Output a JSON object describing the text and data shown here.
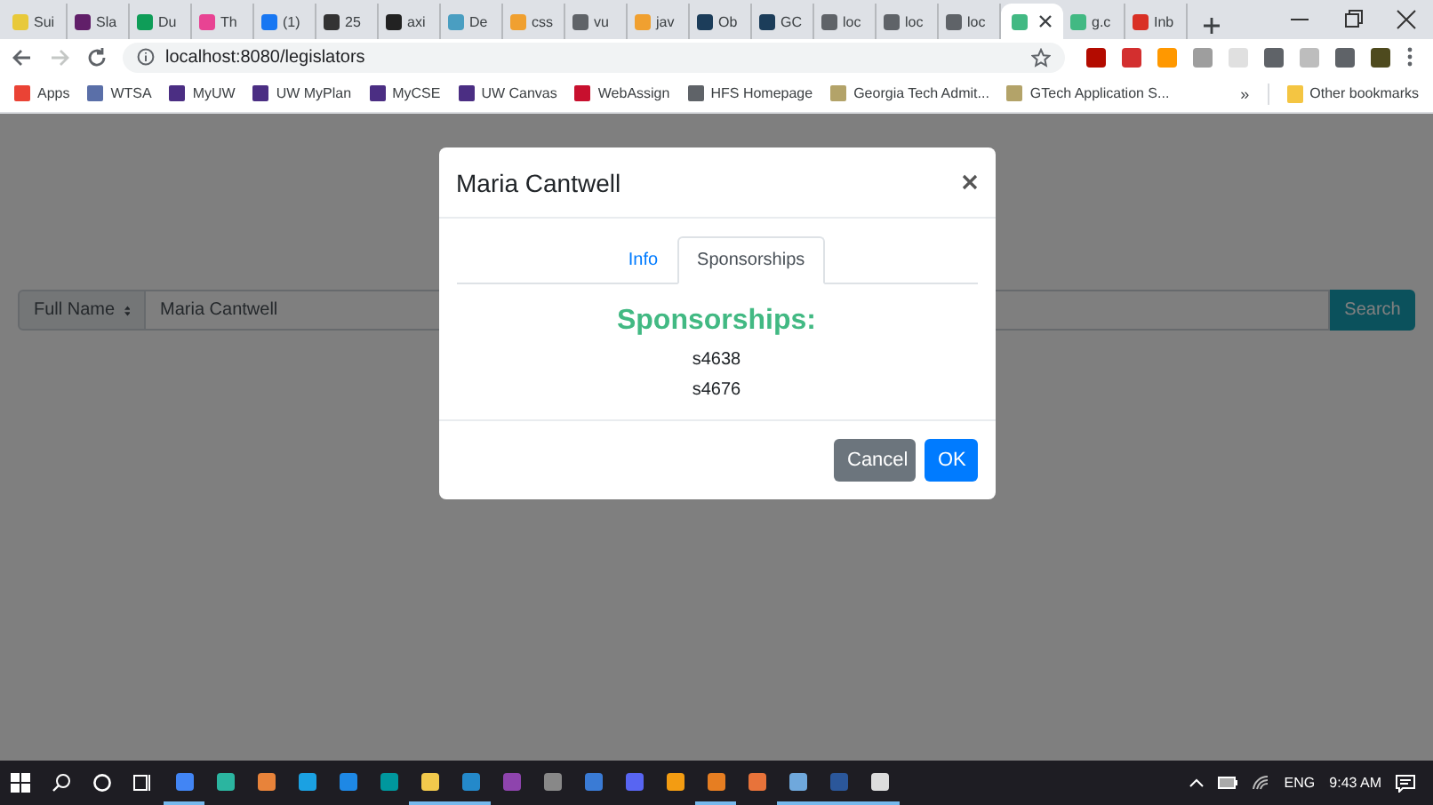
{
  "browser": {
    "tabs": [
      {
        "label": "Sui",
        "color": "#e8c93a",
        "selected": false
      },
      {
        "label": "Sla",
        "color": "#611f69",
        "selected": false
      },
      {
        "label": "Du",
        "color": "#0f9d58",
        "selected": false
      },
      {
        "label": "Th",
        "color": "#e84393",
        "selected": false
      },
      {
        "label": "(1)",
        "color": "#1877f2",
        "selected": false
      },
      {
        "label": "25",
        "color": "#333333",
        "selected": false
      },
      {
        "label": "axi",
        "color": "#222222",
        "selected": false
      },
      {
        "label": "De",
        "color": "#4a9ec1",
        "selected": false
      },
      {
        "label": "css",
        "color": "#f0a030",
        "selected": false
      },
      {
        "label": "vu",
        "color": "#5f6368",
        "selected": false
      },
      {
        "label": "jav",
        "color": "#f0a030",
        "selected": false
      },
      {
        "label": "Ob",
        "color": "#1c3d5a",
        "selected": false
      },
      {
        "label": "GC",
        "color": "#1c3d5a",
        "selected": false
      },
      {
        "label": "loc",
        "color": "#5f6368",
        "selected": false
      },
      {
        "label": "loc",
        "color": "#5f6368",
        "selected": false
      },
      {
        "label": "loc",
        "color": "#5f6368",
        "selected": false
      },
      {
        "color": "#42b983",
        "selected": true
      },
      {
        "label": "g.c",
        "color": "#42b983",
        "selected": false
      },
      {
        "label": "Inb",
        "color": "#d93025",
        "selected": false
      }
    ],
    "address": "localhost:8080/legislators",
    "bookmarks": [
      {
        "label": "Apps",
        "color": "#ea4335"
      },
      {
        "label": "WTSA",
        "color": "#5a6fa8"
      },
      {
        "label": "MyUW",
        "color": "#4b2e83"
      },
      {
        "label": "UW MyPlan",
        "color": "#4b2e83"
      },
      {
        "label": "MyCSE",
        "color": "#4b2e83"
      },
      {
        "label": "UW Canvas",
        "color": "#4b2e83"
      },
      {
        "label": "WebAssign",
        "color": "#c8102e"
      },
      {
        "label": "HFS Homepage",
        "color": "#5f6368"
      },
      {
        "label": "Georgia Tech Admit...",
        "color": "#b3a369"
      },
      {
        "label": "GTech Application S...",
        "color": "#b3a369"
      }
    ],
    "bookmarks_overflow": "»",
    "other_bookmarks": "Other bookmarks"
  },
  "page": {
    "search": {
      "field_select": "Full Name",
      "value": "Maria Cantwell",
      "button": "Search"
    }
  },
  "modal": {
    "title": "Maria Cantwell",
    "tabs": [
      {
        "label": "Info",
        "selected": false
      },
      {
        "label": "Sponsorships",
        "selected": true
      }
    ],
    "heading": "Sponsorships:",
    "items": [
      "s4638",
      "s4676"
    ],
    "buttons": [
      {
        "label": "Cancel",
        "kind": "secondary"
      },
      {
        "label": "OK",
        "kind": "primary"
      }
    ]
  },
  "taskbar": {
    "apps": [
      {
        "color": "#4285f4",
        "running": true
      },
      {
        "color": "#2bb5a0",
        "running": false
      },
      {
        "color": "#e8833a",
        "running": false
      },
      {
        "color": "#1ba1e2",
        "running": false
      },
      {
        "color": "#1e88e5",
        "running": false
      },
      {
        "color": "#00979d",
        "running": false
      },
      {
        "color": "#f2c94c",
        "running": true
      },
      {
        "color": "#2489ca",
        "running": true
      },
      {
        "color": "#8e44ad",
        "running": false
      },
      {
        "color": "#888888",
        "running": false
      },
      {
        "color": "#3a7bd5",
        "running": false
      },
      {
        "color": "#5865f2",
        "running": false
      },
      {
        "color": "#f39c12",
        "running": false
      },
      {
        "color": "#e67e22",
        "running": true
      },
      {
        "color": "#e8733a",
        "running": false
      },
      {
        "color": "#6fa8dc",
        "running": true
      },
      {
        "color": "#2b579a",
        "running": true
      },
      {
        "color": "#dddddd",
        "running": true
      }
    ],
    "language": "ENG",
    "time": "9:43 AM"
  }
}
